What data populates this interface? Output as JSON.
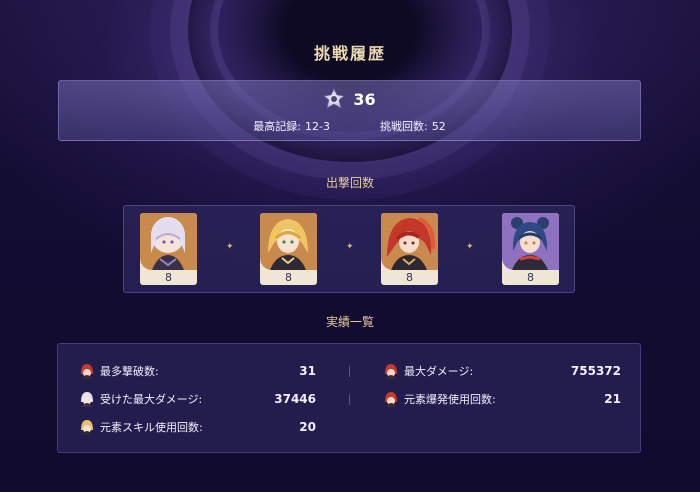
{
  "header": {
    "title": "挑戦履歴"
  },
  "summary": {
    "score": "36",
    "best_label": "最高記録:",
    "best_value": "12-3",
    "attempts_label": "挑戦回数:",
    "attempts_value": "52"
  },
  "sortie": {
    "title": "出撃回数",
    "characters": [
      {
        "icon": "white-haired-character-portrait",
        "count": "8",
        "bg": "#c98a4d"
      },
      {
        "icon": "blonde-character-portrait",
        "count": "8",
        "bg": "#c98a4d"
      },
      {
        "icon": "red-haired-character-portrait",
        "count": "8",
        "bg": "#c98a4d"
      },
      {
        "icon": "blue-haired-character-portrait",
        "count": "8",
        "bg": "#8e72c0"
      }
    ]
  },
  "achievements": {
    "title": "実績一覧",
    "items": [
      {
        "label": "最多撃破数:",
        "value": "31",
        "icon": "red-avatar-icon"
      },
      {
        "label": "最大ダメージ:",
        "value": "755372",
        "icon": "red-avatar-icon"
      },
      {
        "label": "受けた最大ダメージ:",
        "value": "37446",
        "icon": "white-avatar-icon"
      },
      {
        "label": "元素爆発使用回数:",
        "value": "21",
        "icon": "red-avatar-icon"
      },
      {
        "label": "元素スキル使用回数:",
        "value": "20",
        "icon": "blonde-avatar-icon"
      }
    ]
  },
  "colors": {
    "accent_gold": "#e6cf9f",
    "panel": "#2c265c"
  }
}
